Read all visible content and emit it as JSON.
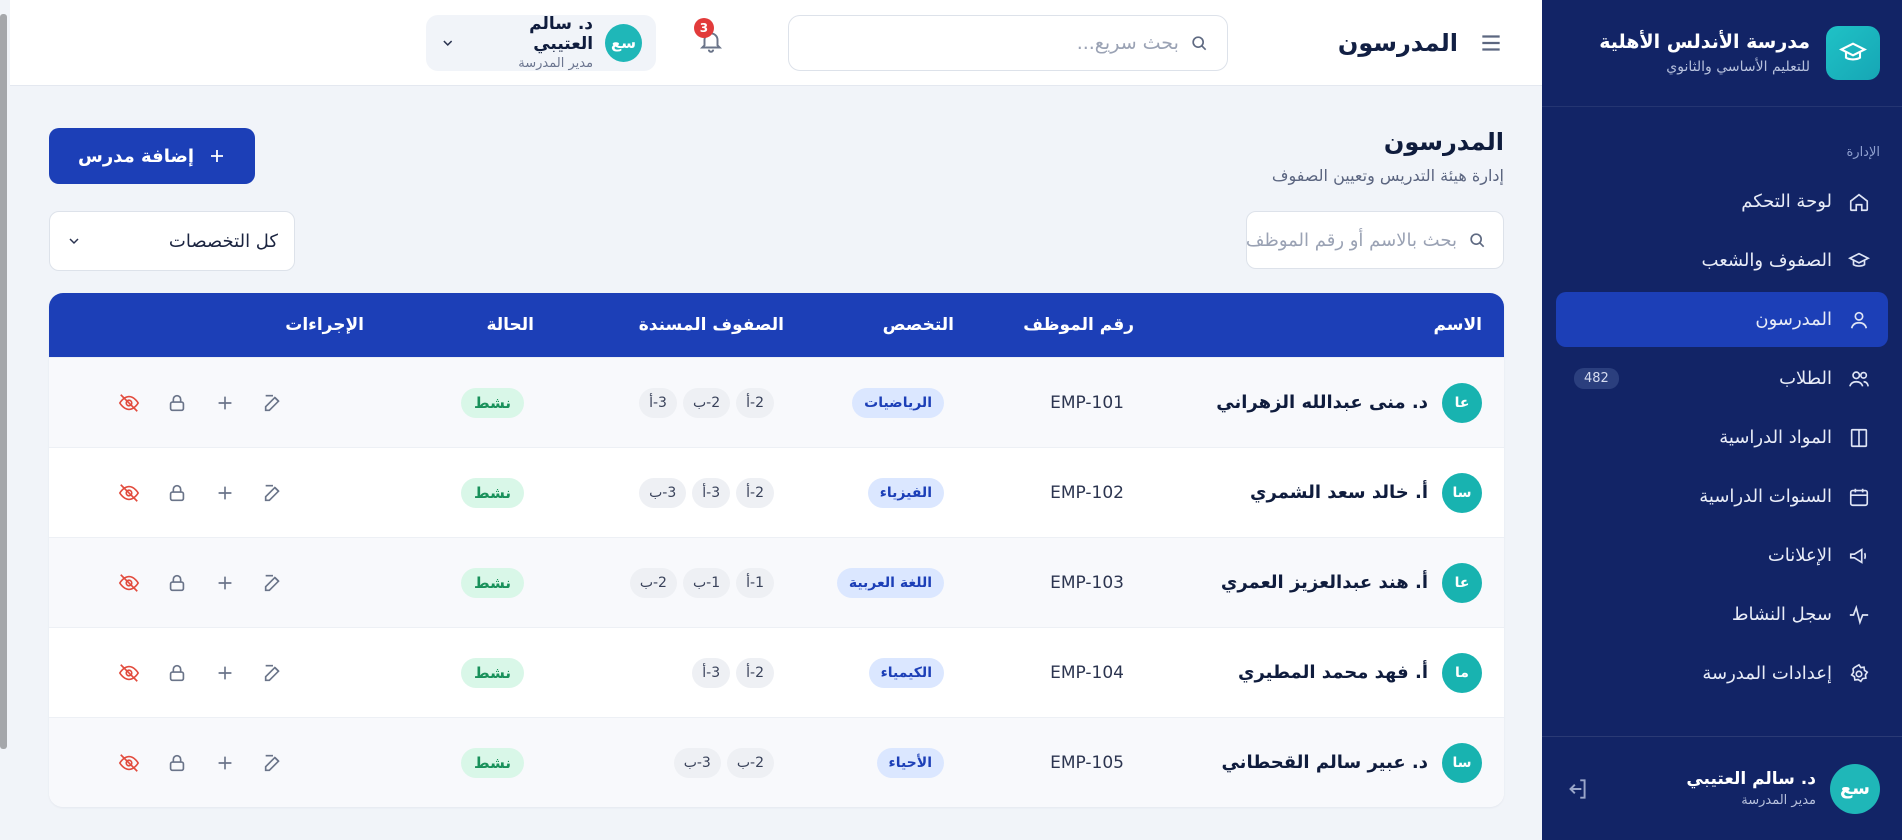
{
  "topbar": {
    "title": "المدرسون",
    "search_placeholder": "بحث سريع...",
    "notification_count": "3",
    "user": {
      "initials": "سع",
      "name": "د. سالم العتيبي",
      "role": "مدير المدرسة"
    }
  },
  "sidebar": {
    "brand_title": "مدرسة الأندلس الأهلية",
    "brand_subtitle": "للتعليم الأساسي والثانوي",
    "section_label": "الإدارة",
    "items": [
      {
        "label": "لوحة التحكم",
        "icon": "home-icon"
      },
      {
        "label": "الصفوف والشعب",
        "icon": "graduation-cap-icon"
      },
      {
        "label": "المدرسون",
        "icon": "user-icon"
      },
      {
        "label": "الطلاب",
        "icon": "users-icon",
        "badge": "482"
      },
      {
        "label": "المواد الدراسية",
        "icon": "book-icon"
      },
      {
        "label": "السنوات الدراسية",
        "icon": "calendar-icon"
      },
      {
        "label": "الإعلانات",
        "icon": "megaphone-icon"
      },
      {
        "label": "سجل النشاط",
        "icon": "activity-icon"
      },
      {
        "label": "إعدادات المدرسة",
        "icon": "settings-icon"
      }
    ],
    "active_item": "المدرسون",
    "footer_user": {
      "initials": "سع",
      "name": "د. سالم العتيبي",
      "role": "مدير المدرسة"
    }
  },
  "page": {
    "title": "المدرسون",
    "subtitle": "إدارة هيئة التدريس وتعيين الصفوف",
    "add_button": "إضافة مدرس",
    "search_placeholder": "بحث بالاسم أو رقم الموظف",
    "specialty_filter": "كل التخصصات"
  },
  "table": {
    "columns": [
      "الاسم",
      "رقم الموظف",
      "التخصص",
      "الصفوف المسندة",
      "الحالة",
      "الإجراءات"
    ],
    "rows": [
      {
        "initials": "عا",
        "name": "د. منى عبدالله الزهراني",
        "emp": "EMP-101",
        "specialty": "الرياضيات",
        "classes": [
          "2-أ",
          "2-ب",
          "3-أ"
        ],
        "status": "نشط"
      },
      {
        "initials": "سا",
        "name": "أ. خالد سعد الشمري",
        "emp": "EMP-102",
        "specialty": "الفيزياء",
        "classes": [
          "2-أ",
          "3-أ",
          "3-ب"
        ],
        "status": "نشط"
      },
      {
        "initials": "عا",
        "name": "أ. هند عبدالعزيز العمري",
        "emp": "EMP-103",
        "specialty": "اللغة العربية",
        "classes": [
          "1-أ",
          "1-ب",
          "2-ب"
        ],
        "status": "نشط"
      },
      {
        "initials": "ما",
        "name": "أ. فهد محمد المطيري",
        "emp": "EMP-104",
        "specialty": "الكيمياء",
        "classes": [
          "2-أ",
          "3-أ"
        ],
        "status": "نشط"
      },
      {
        "initials": "سا",
        "name": "د. عبير سالم القحطاني",
        "emp": "EMP-105",
        "specialty": "الأحياء",
        "classes": [
          "2-ب",
          "3-ب"
        ],
        "status": "نشط"
      }
    ]
  },
  "colors": {
    "primary": "#1c3fb7",
    "sidebar": "#122466",
    "accent": "#1fb7b8",
    "danger": "#e24b3d",
    "success": "#19915b"
  }
}
